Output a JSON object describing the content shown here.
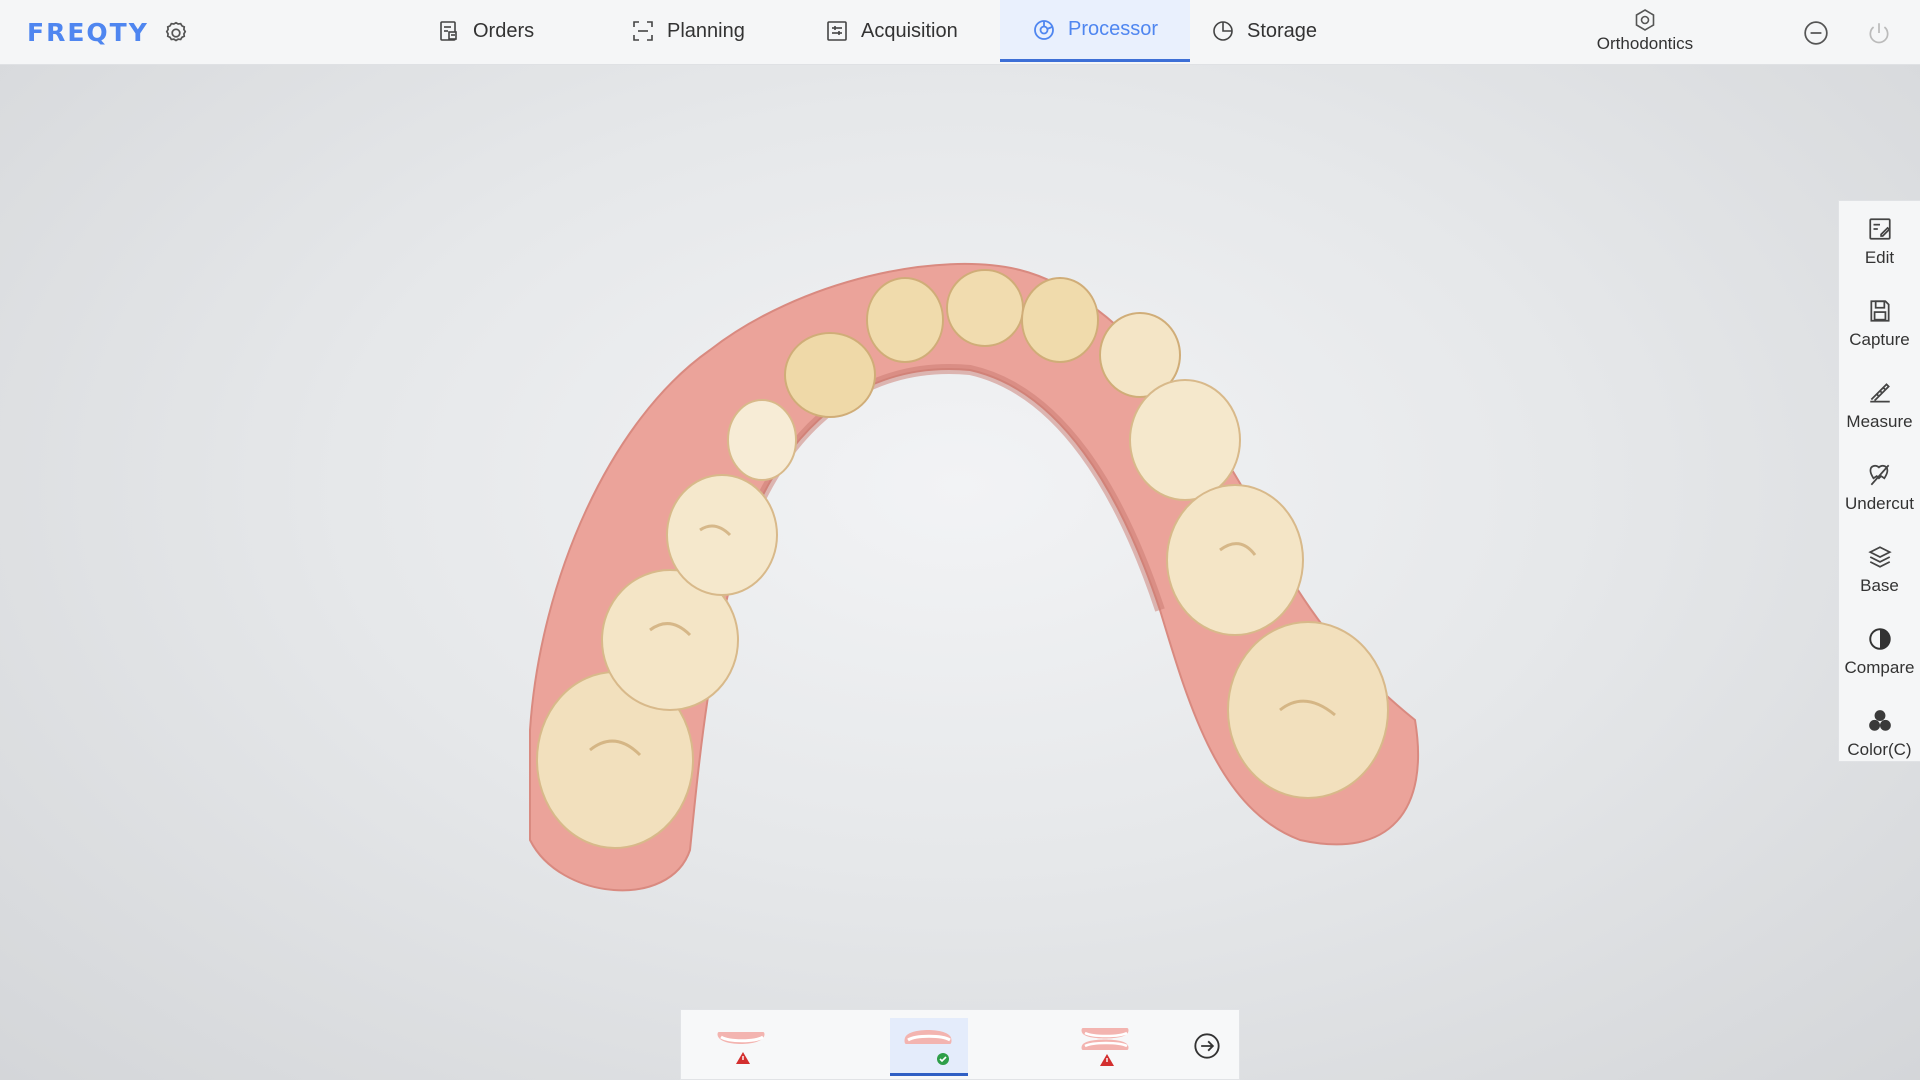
{
  "app": {
    "logo": "FREQTY"
  },
  "nav": {
    "tabs": [
      {
        "label": "Orders",
        "icon": "orders-icon"
      },
      {
        "label": "Planning",
        "icon": "planning-icon"
      },
      {
        "label": "Acquisition",
        "icon": "acquisition-icon"
      },
      {
        "label": "Processor",
        "icon": "processor-icon",
        "active": true
      },
      {
        "label": "Storage",
        "icon": "storage-icon"
      }
    ]
  },
  "module": {
    "label": "Orthodontics",
    "icon": "hexagon-gear-icon"
  },
  "tools": [
    {
      "label": "Edit",
      "icon": "edit-icon"
    },
    {
      "label": "Capture",
      "icon": "save-icon"
    },
    {
      "label": "Measure",
      "icon": "ruler-icon"
    },
    {
      "label": "Undercut",
      "icon": "undercut-icon"
    },
    {
      "label": "Base",
      "icon": "layers-icon"
    },
    {
      "label": "Compare",
      "icon": "half-circle-icon"
    },
    {
      "label": "Color(C)",
      "icon": "color-dots-icon"
    }
  ],
  "scans": [
    {
      "name": "upper-jaw",
      "status": "warning"
    },
    {
      "name": "lower-jaw",
      "status": "ok",
      "active": true
    },
    {
      "name": "bite",
      "status": "warning"
    }
  ],
  "colors": {
    "accent": "#4f86f0",
    "active_underline": "#3d6fd6",
    "warning": "#d32f2f",
    "ok": "#2e9e48",
    "gum": "#e9a59b",
    "tooth": "#f3e4c4"
  }
}
